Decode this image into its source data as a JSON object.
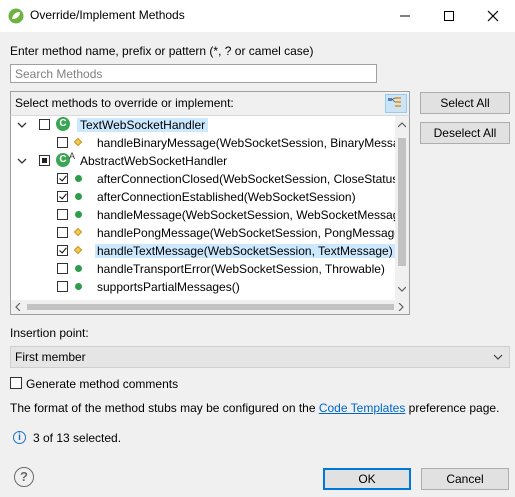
{
  "window": {
    "title": "Override/Implement Methods",
    "app_icon": "spring-leaf-icon",
    "controls": [
      "minimize-icon",
      "maximize-icon",
      "close-icon"
    ]
  },
  "filter": {
    "label": "Enter method name, prefix or pattern (*, ? or camel case)",
    "placeholder": "Search Methods",
    "value": ""
  },
  "tree": {
    "header": "Select methods to override or implement:",
    "view_button_icon": "hierarchy-view-icon",
    "rows": [
      {
        "kind": "class",
        "text": "TextWebSocketHandler",
        "expanded": true,
        "checked": "none",
        "icon": "class-icon",
        "selected": true
      },
      {
        "kind": "method",
        "text": "handleBinaryMessage(WebSocketSession, BinaryMessage)",
        "checked": "none",
        "icon": "protected-method-icon"
      },
      {
        "kind": "class",
        "text": "AbstractWebSocketHandler",
        "expanded": true,
        "checked": "partial",
        "icon": "abstract-class-icon"
      },
      {
        "kind": "method",
        "text": "afterConnectionClosed(WebSocketSession, CloseStatus)",
        "checked": "checked",
        "icon": "public-method-icon"
      },
      {
        "kind": "method",
        "text": "afterConnectionEstablished(WebSocketSession)",
        "checked": "checked",
        "icon": "public-method-icon"
      },
      {
        "kind": "method",
        "text": "handleMessage(WebSocketSession, WebSocketMessage<?>)",
        "checked": "none",
        "icon": "public-method-icon"
      },
      {
        "kind": "method",
        "text": "handlePongMessage(WebSocketSession, PongMessage)",
        "checked": "none",
        "icon": "protected-method-icon"
      },
      {
        "kind": "method",
        "text": "handleTextMessage(WebSocketSession, TextMessage)",
        "checked": "checked",
        "icon": "protected-method-icon",
        "highlight": true
      },
      {
        "kind": "method",
        "text": "handleTransportError(WebSocketSession, Throwable)",
        "checked": "none",
        "icon": "public-method-icon"
      },
      {
        "kind": "method",
        "text": "supportsPartialMessages()",
        "checked": "none",
        "icon": "public-method-icon"
      }
    ]
  },
  "buttons": {
    "select_all": "Select All",
    "deselect_all": "Deselect All",
    "ok": "OK",
    "cancel": "Cancel"
  },
  "insertion": {
    "label": "Insertion point:",
    "value": "First member"
  },
  "generate_comments": {
    "label": "Generate method comments",
    "checked": false
  },
  "stub_info": {
    "prefix": "The format of the method stubs may be configured on the ",
    "link": "Code Templates",
    "suffix": " preference page."
  },
  "status": {
    "text": "3 of 13 selected."
  }
}
